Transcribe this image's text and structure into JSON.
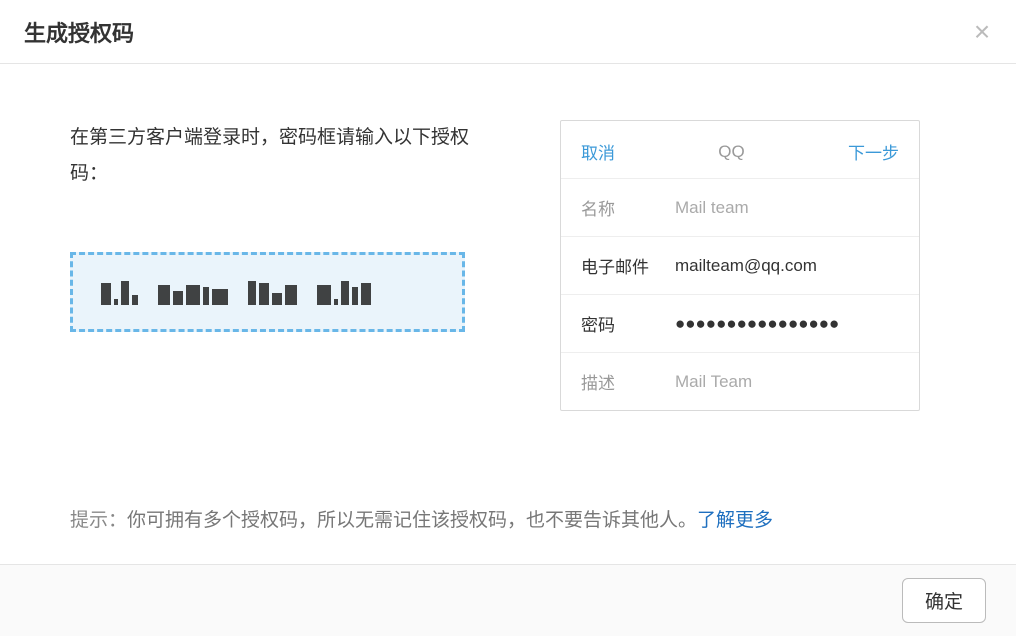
{
  "dialog": {
    "title": "生成授权码",
    "close_label": "×"
  },
  "instruction": "在第三方客户端登录时，密码框请输入以下授权码：",
  "phone": {
    "cancel": "取消",
    "title": "QQ",
    "next": "下一步",
    "rows": {
      "name_label": "名称",
      "name_value": "Mail team",
      "email_label": "电子邮件",
      "email_value": "mailteam@qq.com",
      "password_label": "密码",
      "password_value": "●●●●●●●●●●●●●●●●",
      "desc_label": "描述",
      "desc_value": "Mail Team"
    }
  },
  "hint": {
    "prefix": "提示：",
    "body": "你可拥有多个授权码，所以无需记住该授权码，也不要告诉其他人。",
    "link": "了解更多"
  },
  "footer": {
    "confirm": "确定"
  }
}
